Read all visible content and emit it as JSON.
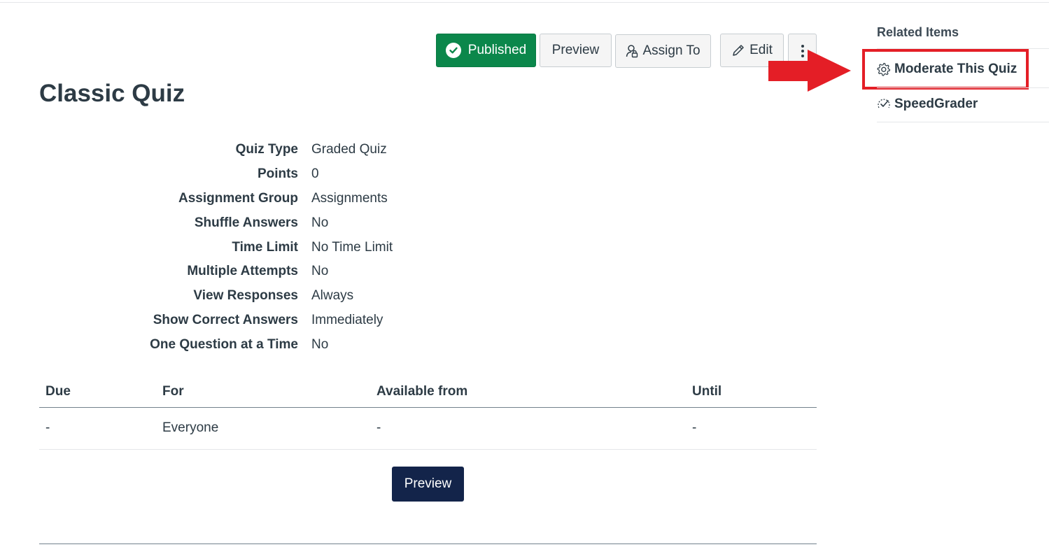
{
  "toolbar": {
    "published_label": "Published",
    "preview_label": "Preview",
    "assign_label": "Assign To",
    "edit_label": "Edit",
    "more_icon": "kebab-vertical-icon"
  },
  "quiz": {
    "title": "Classic Quiz",
    "details": [
      {
        "label": "Quiz Type",
        "value": "Graded Quiz"
      },
      {
        "label": "Points",
        "value": "0"
      },
      {
        "label": "Assignment Group",
        "value": "Assignments"
      },
      {
        "label": "Shuffle Answers",
        "value": "No"
      },
      {
        "label": "Time Limit",
        "value": "No Time Limit"
      },
      {
        "label": "Multiple Attempts",
        "value": "No"
      },
      {
        "label": "View Responses",
        "value": "Always"
      },
      {
        "label": "Show Correct Answers",
        "value": "Immediately"
      },
      {
        "label": "One Question at a Time",
        "value": "No"
      }
    ]
  },
  "due_table": {
    "headers": [
      "Due",
      "For",
      "Available from",
      "Until"
    ],
    "rows": [
      [
        "-",
        "Everyone",
        "-",
        "-"
      ]
    ]
  },
  "preview_button_label": "Preview",
  "related": {
    "title": "Related Items",
    "items": [
      {
        "label": "Moderate This Quiz",
        "icon": "gear-icon"
      },
      {
        "label": "SpeedGrader",
        "icon": "speedgrader-icon"
      }
    ]
  },
  "colors": {
    "published_green": "#0b874b",
    "primary_navy": "#13244a",
    "annotation_red": "#e41e26",
    "text": "#2d3b45"
  }
}
